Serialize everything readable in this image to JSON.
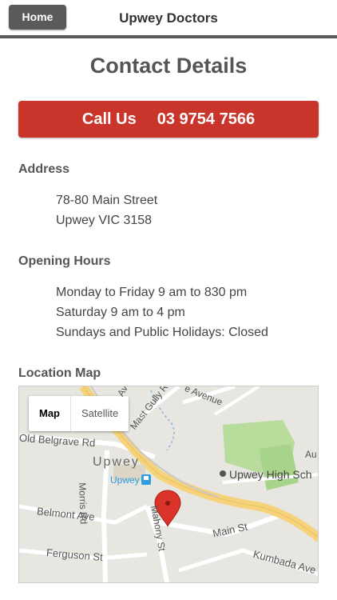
{
  "header": {
    "home_label": "Home",
    "title": "Upwey Doctors"
  },
  "page": {
    "title": "Contact Details"
  },
  "call": {
    "label": "Call Us",
    "number": "03 9754 7566"
  },
  "address": {
    "heading": "Address",
    "lines": [
      "78-80 Main Street",
      "Upwey VIC 3158"
    ]
  },
  "hours": {
    "heading": "Opening Hours",
    "lines": [
      "Monday to Friday 9 am to 830 pm",
      "Saturday 9 am to 4 pm",
      "Sundays and Public Holidays: Closed"
    ]
  },
  "map": {
    "heading": "Location Map",
    "toggle": {
      "map": "Map",
      "satellite": "Satellite"
    },
    "labels": {
      "old_belgrave_rd": "Old Belgrave Rd",
      "upwey": "Upwey",
      "upwey_station": "Upwey",
      "upwey_high_school": "Upwey High Sch",
      "morris_rd": "Morris Rd",
      "belmont_ave": "Belmont Ave",
      "mahony_st": "Mahony St",
      "main_st": "Main St",
      "ferguson_st": "Ferguson St",
      "kumbada_ave": "Kumbada Ave",
      "mast_gully_rd": "Mast Gully R",
      "avenue": "e Avenue",
      "ave_top": "Ave",
      "au": "Au"
    },
    "colors": {
      "land": "#e8e6e1",
      "major_road": "#f6d37b",
      "minor_road": "#ffffff",
      "park": "#b7dc9b",
      "marker": "#d9332a"
    }
  }
}
